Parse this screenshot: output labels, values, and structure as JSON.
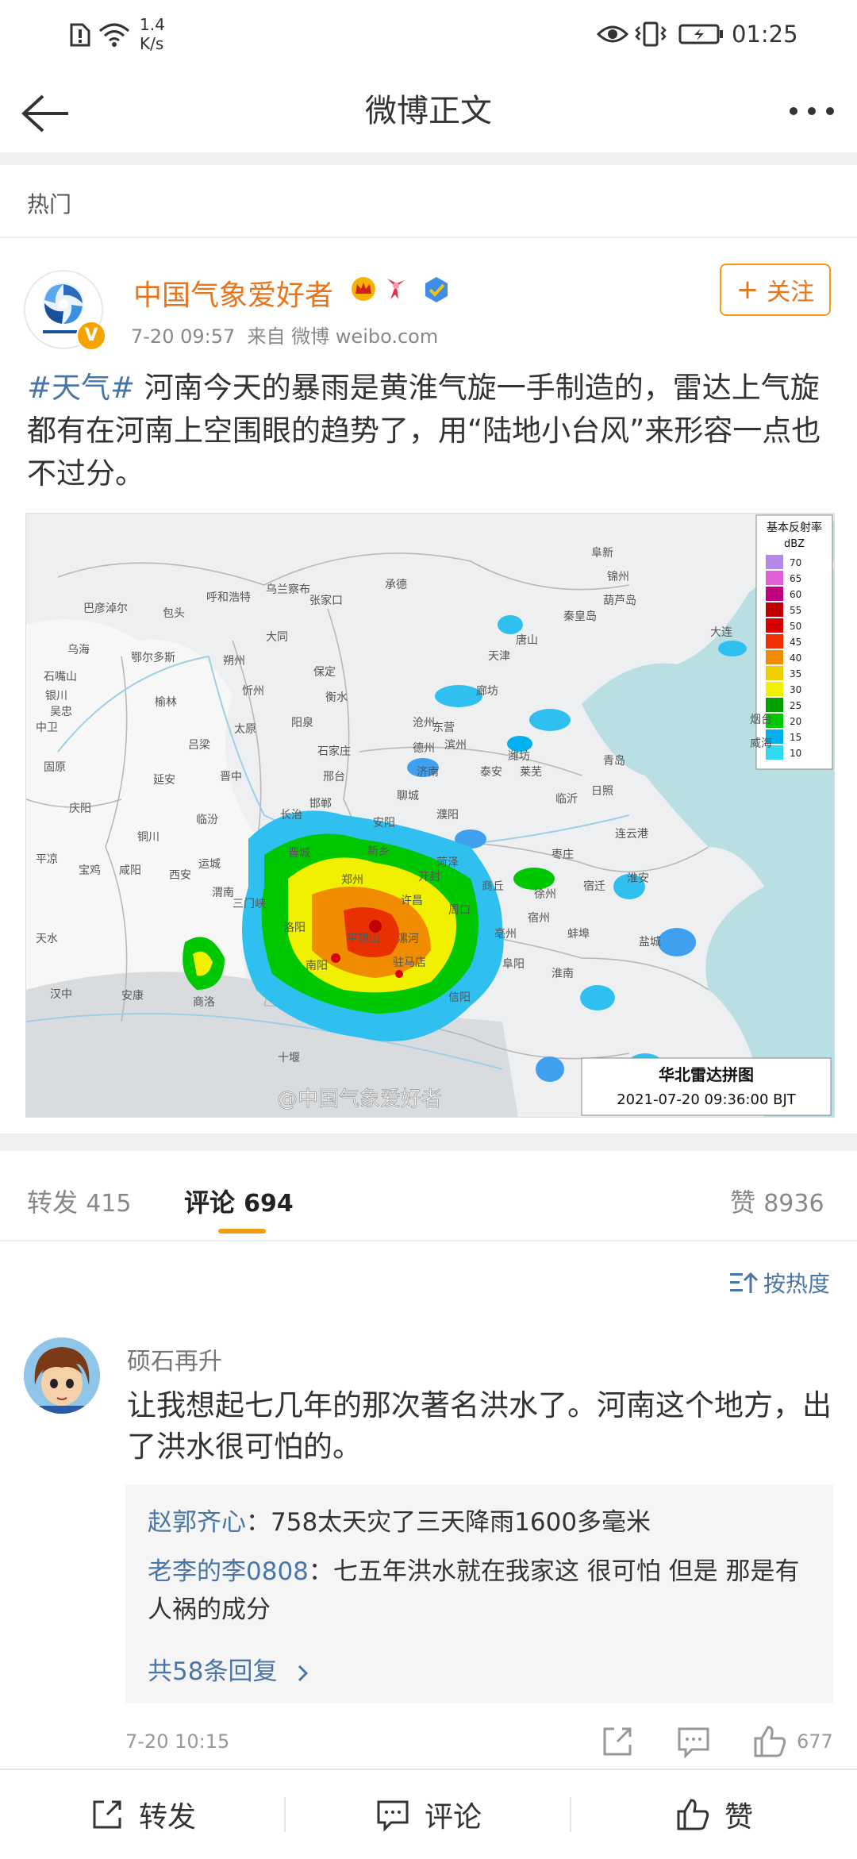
{
  "status_bar": {
    "net_speed_value": "1.4",
    "net_speed_unit": "K/s",
    "time": "01:25"
  },
  "nav": {
    "title": "微博正文"
  },
  "section_label": "热门",
  "post": {
    "author": "中国气象爱好者",
    "time": "7-20 09:57",
    "source_prefix": "来自",
    "source": "微博 weibo.com",
    "follow_label": "关注",
    "topic": "#天气#",
    "text": " 河南今天的暴雨是黄淮气旋一手制造的，雷达上气旋都有在河南上空围眼的趋势了，用“陆地小台风”来形容一点也不过分。"
  },
  "radar_map": {
    "legend_title": "基本反射率",
    "legend_unit": "dBZ",
    "legend_values": [
      "70",
      "65",
      "60",
      "55",
      "50",
      "45",
      "40",
      "35",
      "30",
      "25",
      "20",
      "15",
      "10"
    ],
    "legend_colors": [
      "#b388e6",
      "#e05fd8",
      "#c00080",
      "#c00000",
      "#d80000",
      "#f03000",
      "#f08c00",
      "#f0d000",
      "#f0f000",
      "#00a000",
      "#00c800",
      "#00b0f0",
      "#30d8f0"
    ],
    "caption_title": "华北雷达拼图",
    "caption_time": "2021-07-20 09:36:00 BJT",
    "watermark": "@中国气象爱好者",
    "city_labels": [
      "巴彦淖尔",
      "包头",
      "呼和浩特",
      "乌兰察布",
      "张家口",
      "承德",
      "阜新",
      "锦州",
      "葫芦岛",
      "秦皇岛",
      "唐山",
      "大连",
      "乌海",
      "鄂尔多斯",
      "大同",
      "石嘴山",
      "银川",
      "吴忠",
      "中卫",
      "固原",
      "榆林",
      "朔州",
      "忻州",
      "保定",
      "沧州",
      "天津",
      "廊坊",
      "烟台",
      "威海",
      "太原",
      "阳泉",
      "石家庄",
      "衡水",
      "德州",
      "滨州",
      "东营",
      "潍坊",
      "青岛",
      "日照",
      "济南",
      "泰安",
      "莱芜",
      "临沂",
      "吕梁",
      "晋中",
      "邢台",
      "邯郸",
      "聊城",
      "延安",
      "临汾",
      "长治",
      "安阳",
      "濮阳",
      "菏泽",
      "枣庄",
      "连云港",
      "庆阳",
      "晋城",
      "新乡",
      "开封",
      "商丘",
      "徐州",
      "宿迁",
      "淮安",
      "铜川",
      "运城",
      "郑州",
      "许昌",
      "周口",
      "亳州",
      "宿州",
      "蚌埠",
      "平凉",
      "宝鸡",
      "咸阳",
      "西安",
      "渭南",
      "三门峡",
      "洛阳",
      "平顶山",
      "漯河",
      "阜阳",
      "淮南",
      "天水",
      "汉中",
      "安康",
      "商洛",
      "南阳",
      "驻马店",
      "信阳",
      "十堰",
      "盐城"
    ]
  },
  "tabs": {
    "repost_label": "转发",
    "repost_count": "415",
    "comment_label": "评论",
    "comment_count": "694",
    "like_label": "赞",
    "like_count": "8936"
  },
  "sort_label": "按热度",
  "comment": {
    "author": "硕石再升",
    "text": "让我想起七几年的那次著名洪水了。河南这个地方，出了洪水很可怕的。",
    "replies": [
      {
        "user": "赵郭齐心",
        "text": "：758太天灾了三天降雨1600多毫米"
      },
      {
        "user": "老李的李0808",
        "text": "：七五年洪水就在我家这 很可怕 但是 那是有人祸的成分"
      }
    ],
    "more_replies": "共58条回复",
    "time": "7-20 10:15",
    "like_count": "677"
  },
  "bottom_bar": {
    "repost": "转发",
    "comment": "评论",
    "like": "赞"
  },
  "colors": {
    "accent_orange": "#f39c12",
    "name_orange": "#e8741c",
    "link_blue": "#4a75a9"
  }
}
